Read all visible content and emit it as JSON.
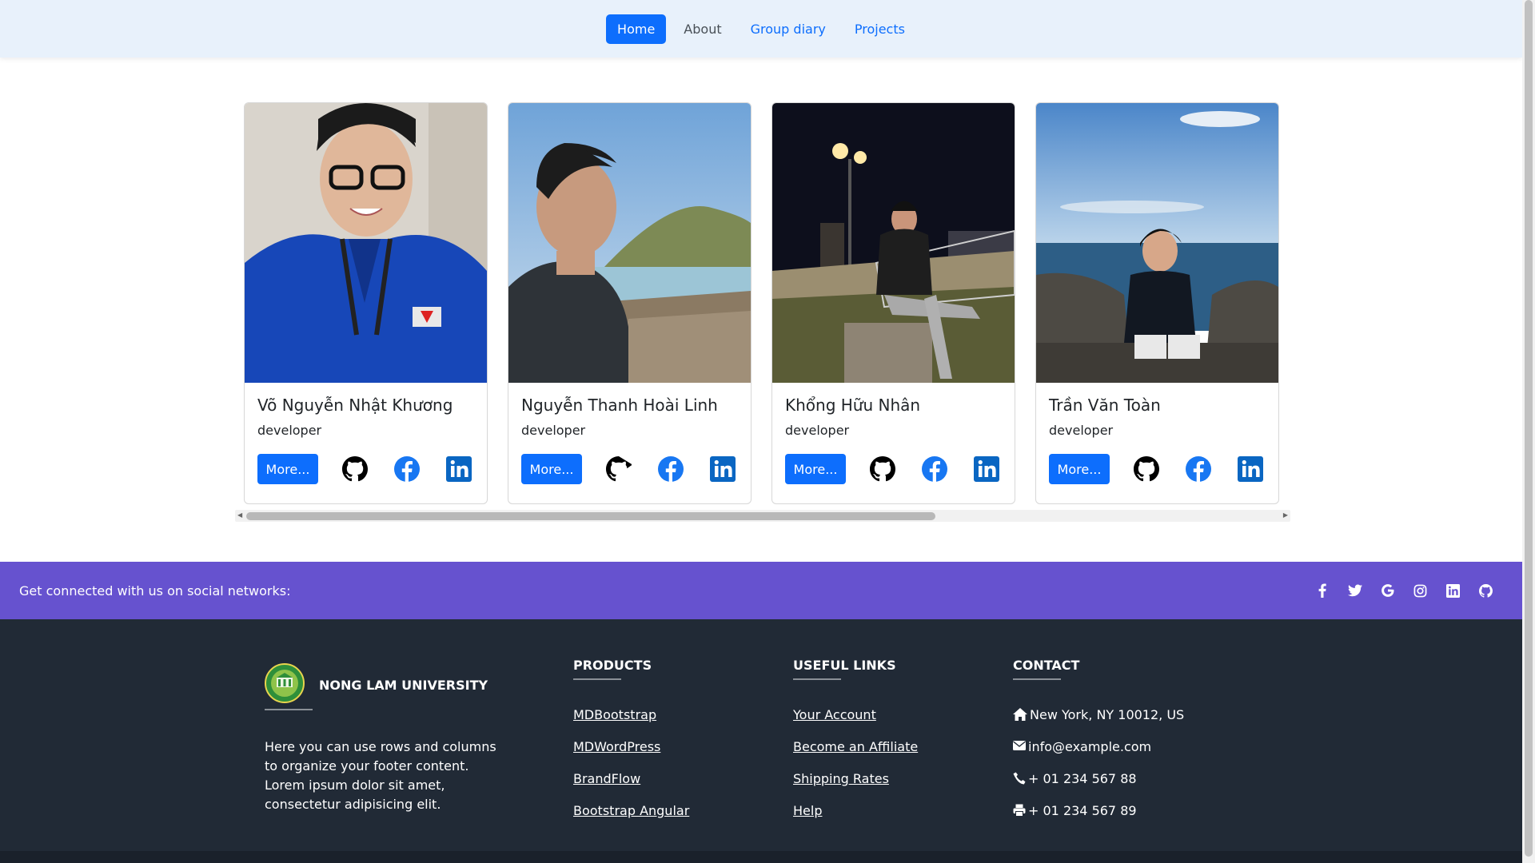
{
  "nav": {
    "items": [
      {
        "label": "Home",
        "active": true
      },
      {
        "label": "About",
        "active": false
      },
      {
        "label": "Group diary",
        "active": false
      },
      {
        "label": "Projects",
        "active": false
      }
    ]
  },
  "members": [
    {
      "name": "Võ Nguyễn Nhật Khương",
      "role": "developer",
      "button": "More..."
    },
    {
      "name": "Nguyễn Thanh Hoài Linh",
      "role": "developer",
      "button": "More..."
    },
    {
      "name": "Khổng Hữu Nhân",
      "role": "developer",
      "button": "More..."
    },
    {
      "name": "Trần Văn Toàn",
      "role": "developer",
      "button": "More..."
    }
  ],
  "card_icons": [
    "github-icon",
    "facebook-icon",
    "linkedin-icon"
  ],
  "social_bar": {
    "text": "Get connected with us on social networks:",
    "icons": [
      "facebook-icon",
      "twitter-icon",
      "google-icon",
      "instagram-icon",
      "linkedin-icon",
      "github-icon"
    ]
  },
  "footer": {
    "brand": {
      "name": "NONG LAM UNIVERSITY",
      "text": "Here you can use rows and columns to organize your footer content. Lorem ipsum dolor sit amet, consectetur adipisicing elit."
    },
    "products": {
      "heading": "PRODUCTS",
      "links": [
        "MDBootstrap",
        "MDWordPress",
        "BrandFlow",
        "Bootstrap Angular"
      ]
    },
    "useful_links": {
      "heading": "USEFUL LINKS",
      "links": [
        "Your Account",
        "Become an Affiliate",
        "Shipping Rates",
        "Help"
      ]
    },
    "contact": {
      "heading": "CONTACT",
      "items": [
        {
          "icon": "home-icon",
          "text": "New York, NY 10012, US"
        },
        {
          "icon": "envelope-icon",
          "text": "info@example.com"
        },
        {
          "icon": "phone-icon",
          "text": "+ 01 234 567 88"
        },
        {
          "icon": "print-icon",
          "text": "+ 01 234 567 89"
        }
      ]
    }
  },
  "colors": {
    "primary": "#0d6efd",
    "navbar_bg": "#e8f1fb",
    "social_bar_bg": "#6652cf",
    "footer_bg": "#212a36"
  }
}
